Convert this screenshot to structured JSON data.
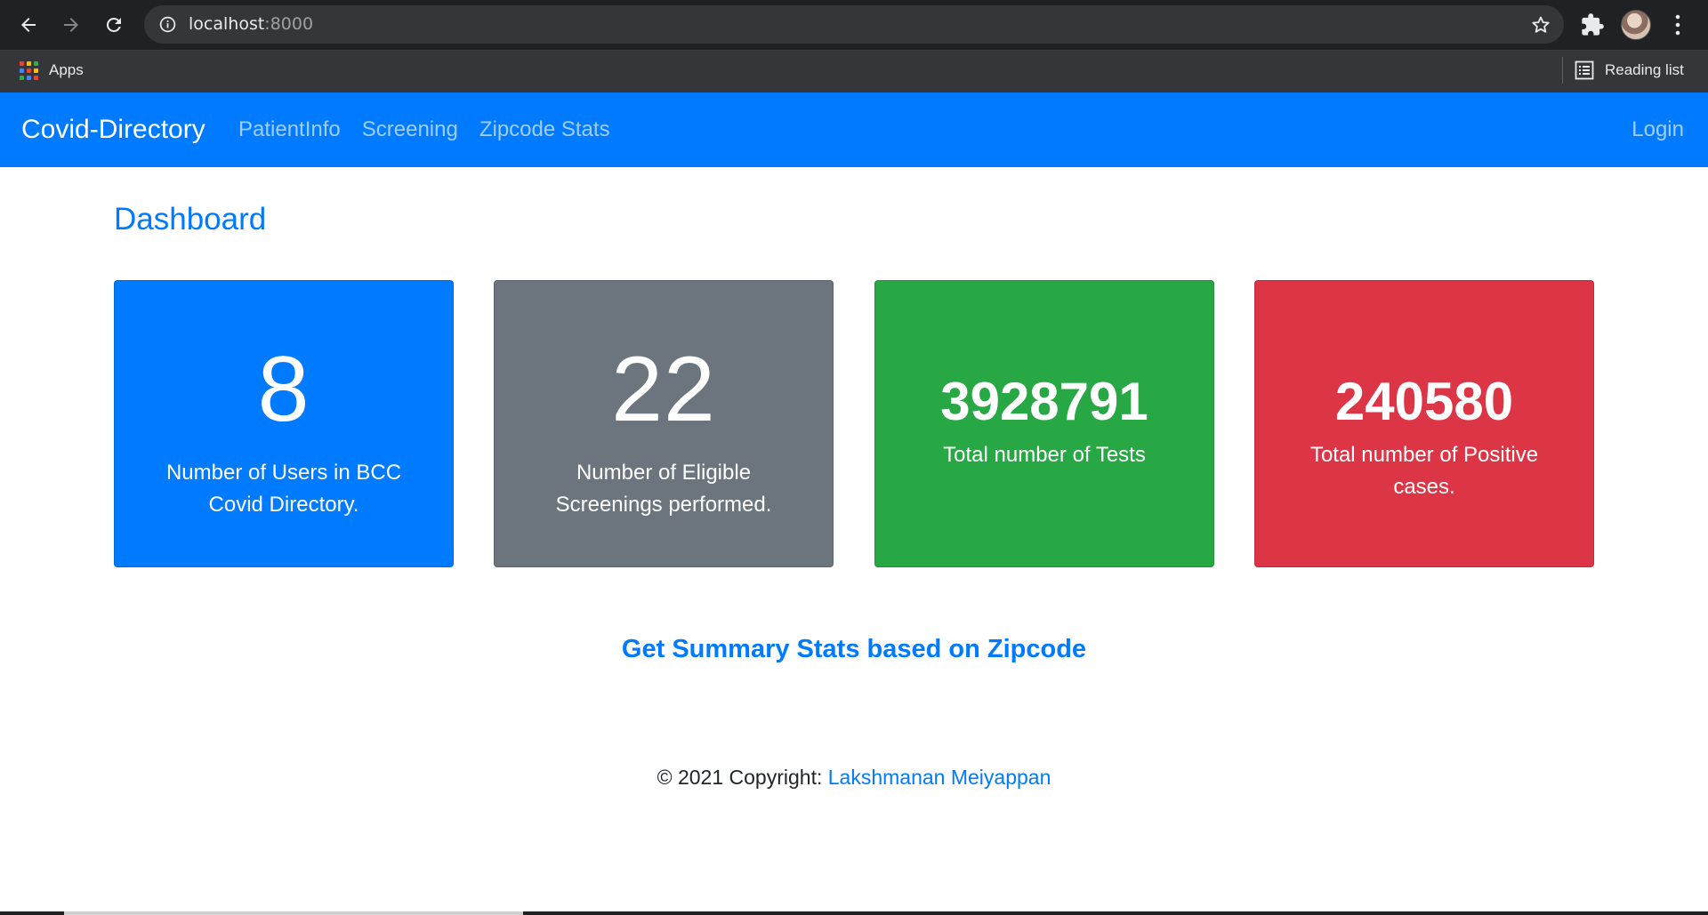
{
  "browser": {
    "url_host": "localhost",
    "url_port": ":8000",
    "bookmarks": {
      "apps_label": "Apps",
      "reading_list_label": "Reading list"
    }
  },
  "navbar": {
    "brand": "Covid-Directory",
    "links": [
      "PatientInfo",
      "Screening",
      "Zipcode Stats"
    ],
    "login": "Login",
    "color": "#007bff"
  },
  "main": {
    "title": "Dashboard",
    "cards": [
      {
        "value": "8",
        "label": "Number of Users in BCC Covid Directory.",
        "color": "#007bff"
      },
      {
        "value": "22",
        "label": "Number of Eligible Screenings performed.",
        "color": "#6c757d"
      },
      {
        "value": "3928791",
        "label": "Total number of Tests",
        "color": "#28a745"
      },
      {
        "value": "240580",
        "label": "Total number of Positive cases.",
        "color": "#dc3545"
      }
    ],
    "summary_link": "Get Summary Stats based on Zipcode"
  },
  "footer": {
    "copyright": "© 2021 Copyright: ",
    "author": "Lakshmanan Meiyappan"
  }
}
